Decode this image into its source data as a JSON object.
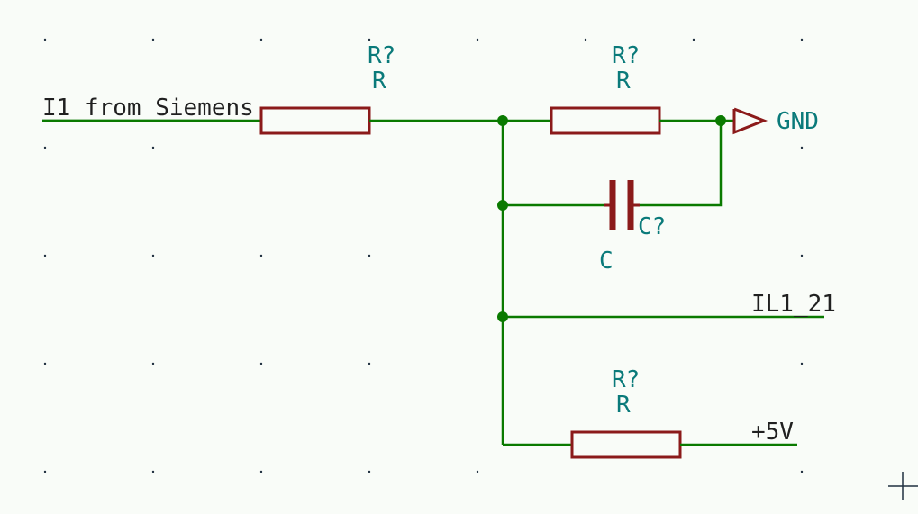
{
  "net_labels": {
    "input": "I1_from_Siemens",
    "gnd": "GND",
    "output": "IL1_21",
    "power": "+5V"
  },
  "components": {
    "r1": {
      "ref": "R?",
      "value": "R"
    },
    "r2": {
      "ref": "R?",
      "value": "R"
    },
    "r3": {
      "ref": "R?",
      "value": "R"
    },
    "c1": {
      "ref": "C?",
      "value": "C"
    }
  },
  "chart_data": {
    "type": "schematic",
    "title": "",
    "nodes": [
      {
        "id": "in",
        "label": "I1_from_Siemens"
      },
      {
        "id": "n1"
      },
      {
        "id": "gnd",
        "label": "GND"
      },
      {
        "id": "out",
        "label": "IL1_21"
      },
      {
        "id": "pwr",
        "label": "+5V"
      }
    ],
    "edges": [
      {
        "from": "in",
        "to": "n1",
        "component": "R?",
        "value": "R"
      },
      {
        "from": "n1",
        "to": "gnd",
        "component": "R?",
        "value": "R"
      },
      {
        "from": "n1",
        "to": "gnd",
        "component": "C?",
        "value": "C"
      },
      {
        "from": "n1",
        "to": "out",
        "component": "wire"
      },
      {
        "from": "n1",
        "to": "pwr",
        "component": "R?",
        "value": "R"
      }
    ]
  }
}
